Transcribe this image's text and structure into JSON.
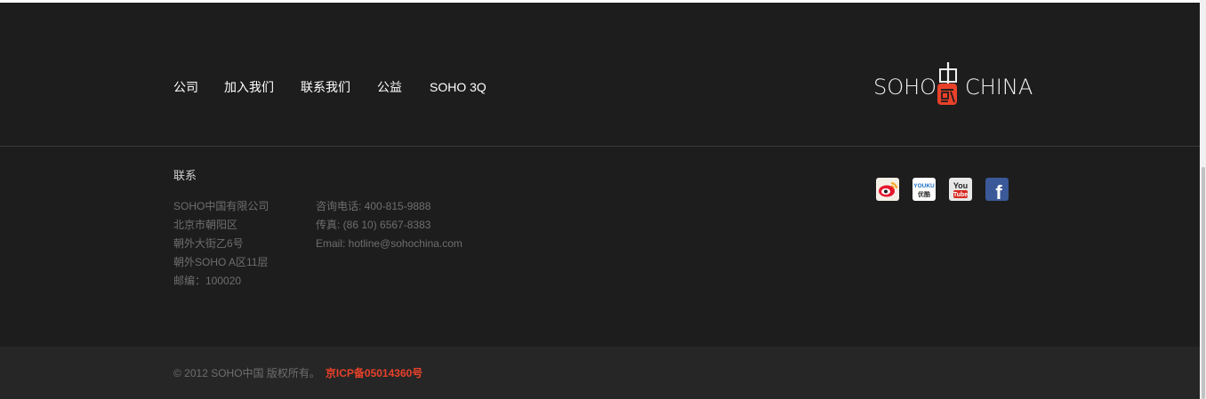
{
  "nav": {
    "items": [
      {
        "label": "公司"
      },
      {
        "label": "加入我们"
      },
      {
        "label": "联系我们"
      },
      {
        "label": "公益"
      },
      {
        "label": "SOHO 3Q"
      }
    ]
  },
  "logo": {
    "left": "SOHO",
    "right": "CHINA"
  },
  "contact": {
    "title": "联系",
    "address": [
      "SOHO中国有限公司",
      "北京市朝阳区",
      "朝外大街乙6号",
      "朝外SOHO A区11层",
      "邮编：100020"
    ],
    "lines": [
      "咨询电话: 400-815-9888",
      "传真: (86 10) 6567-8383",
      "Email: hotline@sohochina.com"
    ]
  },
  "social": {
    "icons": [
      "weibo-icon",
      "youku-icon",
      "youtube-icon",
      "facebook-icon"
    ],
    "youku_text": "YOUKU",
    "youku_cn": "优酷",
    "youtube_text1": "You",
    "youtube_text2": "Tube",
    "facebook_text": "f"
  },
  "copyright": {
    "text": "© 2012 SOHO中国 版权所有。",
    "icp": "京ICP备05014360号"
  },
  "colors": {
    "background": "#1d1d1d",
    "bottom_bar": "#262626",
    "accent": "#e8412a"
  }
}
